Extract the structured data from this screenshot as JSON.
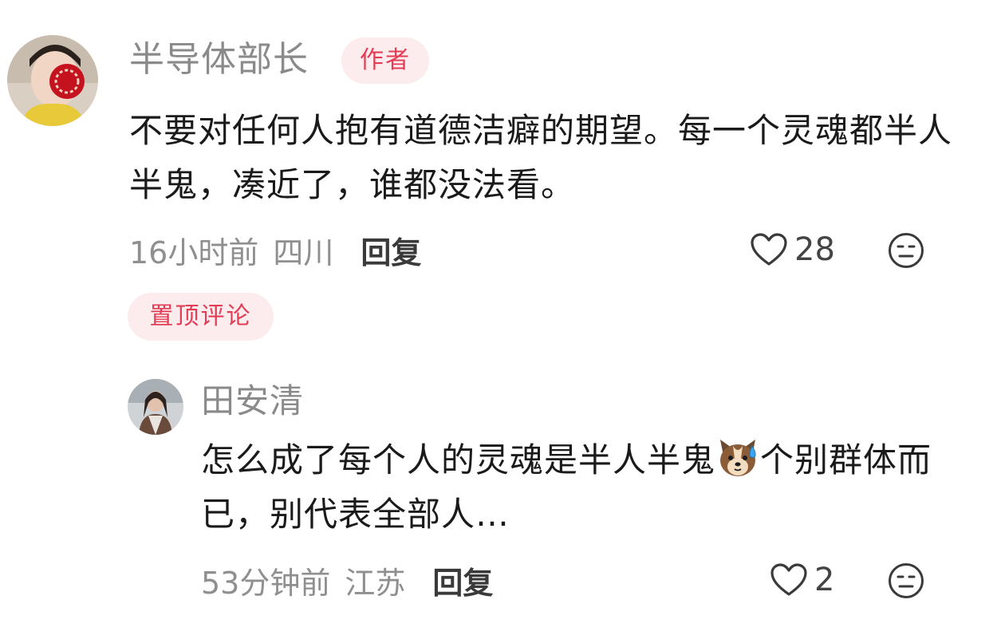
{
  "comments": [
    {
      "username": "半导体部长",
      "badge": "作者",
      "content": "不要对任何人抱有道德洁癖的期望。每一个灵魂都半人半鬼，凑近了，谁都没法看。",
      "time": "16小时前",
      "location": "四川",
      "reply_label": "回复",
      "likes": "28",
      "pinned_label": "置顶评论"
    },
    {
      "username": "田安清",
      "content_before_emoji": "怎么成了每个人的灵魂是半人半鬼",
      "emoji_name": "dog-sweat-emoji",
      "content_after_emoji": "个别群体而已，别代表全部人…",
      "time": "53分钟前",
      "location": "江苏",
      "reply_label": "回复",
      "likes": "2"
    }
  ],
  "icons": {
    "like": "heart-outline-icon",
    "reaction": "neutral-face-icon"
  },
  "colors": {
    "badge_bg": "#fdecee",
    "badge_text": "#e33d56",
    "meta_text": "#8f8f8f"
  }
}
